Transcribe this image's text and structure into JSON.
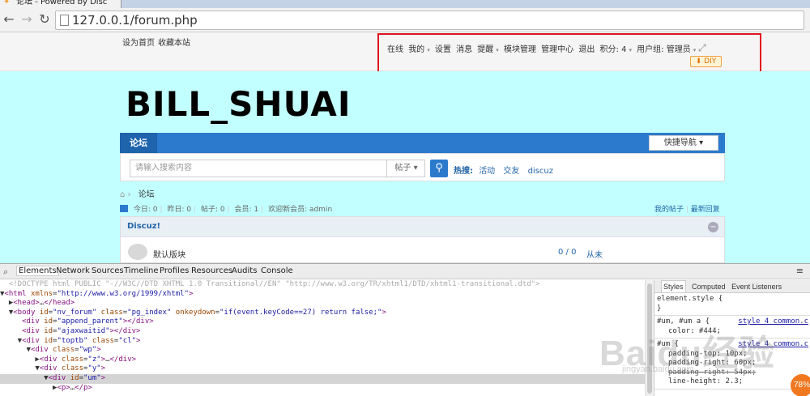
{
  "browser": {
    "tab_title": "论坛 - Powered by Disc",
    "url": "127.0.0.1/forum.php"
  },
  "topbar": {
    "left_links": [
      "设为首页",
      "收藏本站"
    ],
    "user_menu": [
      "在线",
      "我的",
      "设置",
      "消息",
      "提醒",
      "模块管理",
      "管理中心",
      "退出",
      "积分: 4",
      "用户组: 管理员"
    ],
    "diy_label": "DIY"
  },
  "site": {
    "logo_text": "BILL_SHUAI"
  },
  "nav": {
    "tab": "论坛",
    "quick_nav": "快捷导航"
  },
  "search": {
    "placeholder": "请输入搜索内容",
    "type": "帖子",
    "hot_label": "热搜:",
    "hot_words": [
      "活动",
      "交友",
      "discuz"
    ]
  },
  "breadcrumb": {
    "current": "论坛"
  },
  "stats": {
    "items": [
      "今日: 0",
      "昨日: 0",
      "帖子: 0",
      "会员: 1",
      "欢迎新会员: admin"
    ],
    "links": [
      "我的帖子",
      "最新回复"
    ]
  },
  "forum": {
    "group_title": "Discuz!",
    "board_name": "默认版块",
    "counts": "0 / 0",
    "last_post": "从未"
  },
  "devtools": {
    "tabs": [
      "Elements",
      "Network",
      "Sources",
      "Timeline",
      "Profiles",
      "Resources",
      "Audits",
      "Console"
    ],
    "styles_tabs": [
      "Styles",
      "Computed",
      "Event Listeners"
    ],
    "element_style": "element.style {",
    "rule1_selector": "#um, #um a {",
    "rule1_source": "style_4_common.c",
    "rule1_prop": "color: #444;",
    "rule2_selector": "#um {",
    "rule2_source": "style_4_common.c",
    "rule2_props": [
      "padding-top: 10px;",
      "padding-right: 60px;",
      "padding-right: 54px;",
      "line-height: 2.3;"
    ]
  },
  "overlay": {
    "percent": "78%",
    "watermark": "Baidu经验",
    "watermark_sub": "jingyan.baidu.com"
  }
}
